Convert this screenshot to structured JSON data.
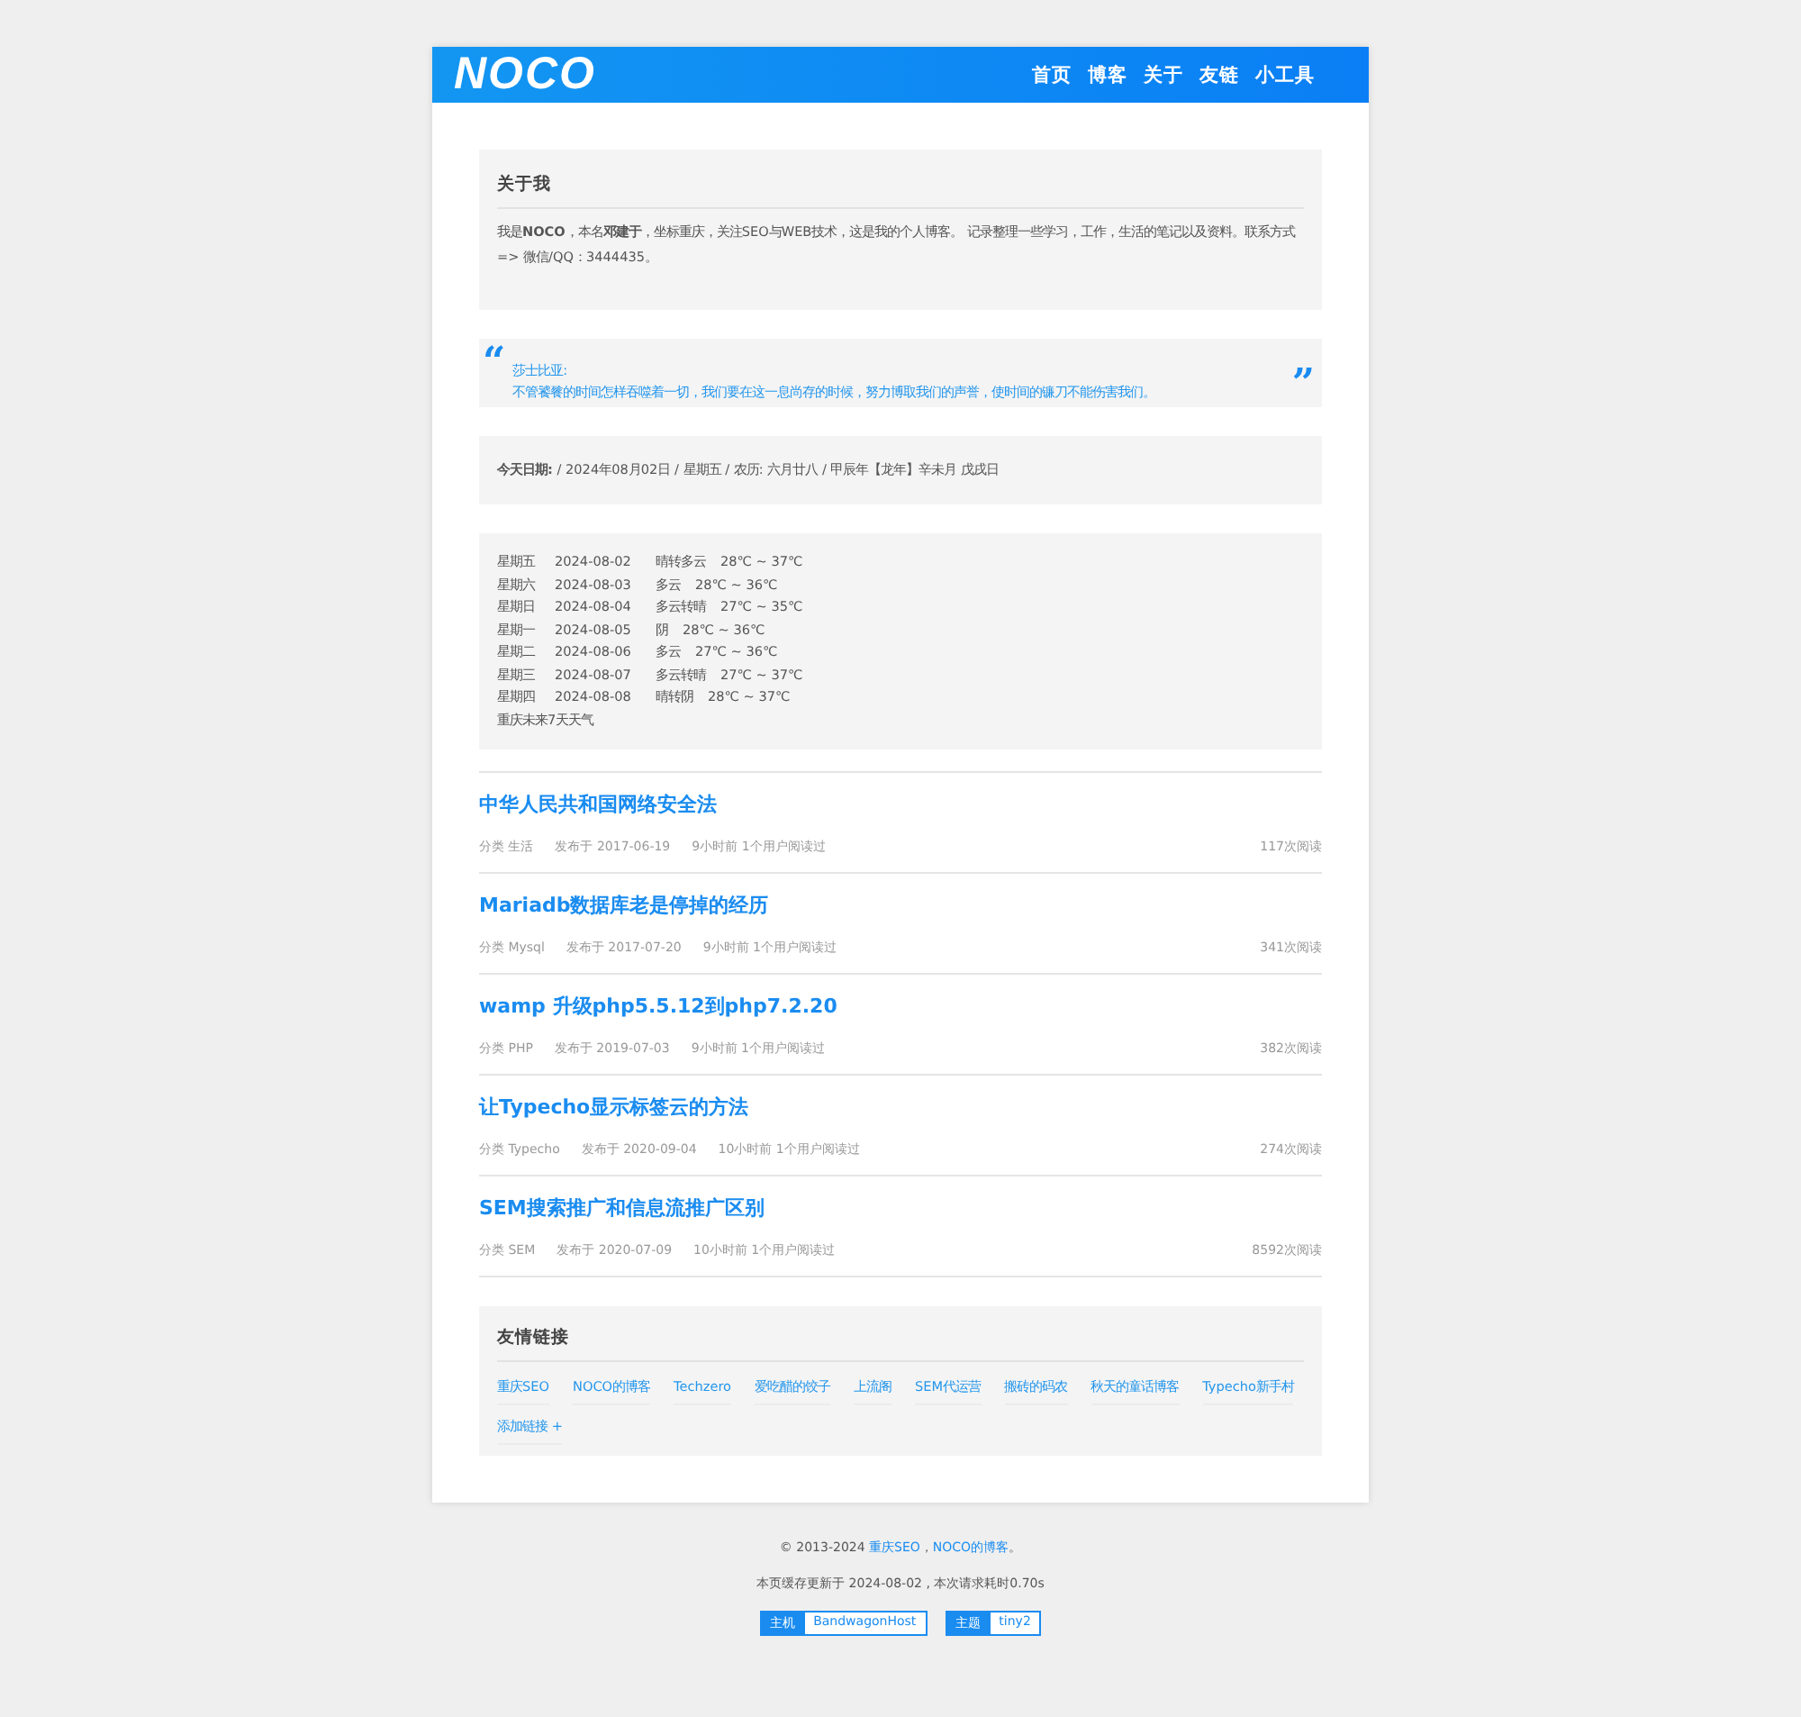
{
  "header": {
    "logo": "NOCO",
    "nav": [
      {
        "label": "首页"
      },
      {
        "label": "博客"
      },
      {
        "label": "关于"
      },
      {
        "label": "友链"
      },
      {
        "label": "小工具"
      }
    ]
  },
  "about": {
    "title": "关于我",
    "text": "我是**NOCO**，本名**邓建于**，坐标重庆，关注SEO与WEB技术，这是我的个人博客。 记录整理一些学习，工作，生活的笔记以及资料。联系方式 => 微信/QQ：3444435。"
  },
  "quote": {
    "open_mark": "“",
    "author": "莎士比亚:",
    "text": "不管饕餮的时间怎样吞噬着一切，我们要在这一息尚存的时候，努力博取我们的声誉，使时间的镰刀不能伤害我们。",
    "close_mark": "”"
  },
  "today": {
    "text": "**今天日期:** / 2024年08月02日 / 星期五 / 农历: 六月廿八 / 甲辰年【龙年】辛未月 戊戌日"
  },
  "weather": {
    "days": [
      {
        "weekday": "星期五",
        "date": "2024-08-02",
        "condition": "晴转多云",
        "temp": "28℃ ~ 37℃"
      },
      {
        "weekday": "星期六",
        "date": "2024-08-03",
        "condition": "多云",
        "temp": "28℃ ~ 36℃"
      },
      {
        "weekday": "星期日",
        "date": "2024-08-04",
        "condition": "多云转晴",
        "temp": "27℃ ~ 35℃"
      },
      {
        "weekday": "星期一",
        "date": "2024-08-05",
        "condition": "阴",
        "temp": "28℃ ~ 36℃"
      },
      {
        "weekday": "星期二",
        "date": "2024-08-06",
        "condition": "多云",
        "temp": "27℃ ~ 36℃"
      },
      {
        "weekday": "星期三",
        "date": "2024-08-07",
        "condition": "多云转晴",
        "temp": "27℃ ~ 37℃"
      },
      {
        "weekday": "星期四",
        "date": "2024-08-08",
        "condition": "晴转阴",
        "temp": "28℃ ~ 37℃"
      }
    ],
    "caption": "重庆未来7天天气"
  },
  "posts": [
    {
      "title": "中华人民共和国网络安全法",
      "category": "分类 生活",
      "published": "发布于 2017-06-19",
      "recent": "9小时前 1个用户阅读过",
      "views": "117次阅读"
    },
    {
      "title": "Mariadb数据库老是停掉的经历",
      "category": "分类 Mysql",
      "published": "发布于 2017-07-20",
      "recent": "9小时前 1个用户阅读过",
      "views": "341次阅读"
    },
    {
      "title": "wamp 升级php5.5.12到php7.2.20",
      "category": "分类 PHP",
      "published": "发布于 2019-07-03",
      "recent": "9小时前 1个用户阅读过",
      "views": "382次阅读"
    },
    {
      "title": "让Typecho显示标签云的方法",
      "category": "分类 Typecho",
      "published": "发布于 2020-09-04",
      "recent": "10小时前 1个用户阅读过",
      "views": "274次阅读"
    },
    {
      "title": "SEM搜索推广和信息流推广区别",
      "category": "分类 SEM",
      "published": "发布于 2020-07-09",
      "recent": "10小时前 1个用户阅读过",
      "views": "8592次阅读"
    }
  ],
  "links": {
    "title": "友情链接",
    "items": [
      "重庆SEO",
      "NOCO的博客",
      "Techzero",
      "爱吃醋的饺子",
      "上流阁",
      "SEM代运营",
      "搬砖的码农",
      "秋天的童话博客",
      "Typecho新手村",
      "添加链接 +"
    ]
  },
  "footer": {
    "copyright": [
      {
        "kind": "text",
        "text": "© 2013-2024 "
      },
      {
        "kind": "link",
        "text": "重庆SEO"
      },
      {
        "kind": "text",
        "text": "，"
      },
      {
        "kind": "link",
        "text": "NOCO的博客"
      },
      {
        "kind": "text",
        "text": "。"
      }
    ],
    "cache": "本页缓存更新于 2024-08-02 , 本次请求耗时0.70s",
    "badges": [
      {
        "label": "主机",
        "value": "BandwagonHost"
      },
      {
        "label": "主题",
        "value": "tiny2"
      }
    ]
  }
}
